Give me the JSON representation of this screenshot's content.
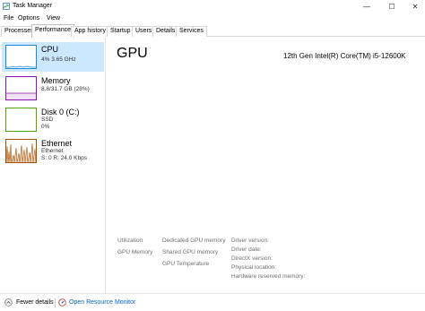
{
  "window": {
    "title": "Task Manager",
    "minimize_glyph": "—",
    "maximize_glyph": "☐",
    "close_glyph": "✕",
    "app_icon": "task-manager-icon"
  },
  "menu": [
    "File",
    "Options",
    "View"
  ],
  "tabs": [
    {
      "label": "Processes",
      "active": false
    },
    {
      "label": "Performance",
      "active": true
    },
    {
      "label": "App history",
      "active": false
    },
    {
      "label": "Startup",
      "active": false
    },
    {
      "label": "Users",
      "active": false
    },
    {
      "label": "Details",
      "active": false
    },
    {
      "label": "Services",
      "active": false
    }
  ],
  "sidebar": {
    "items": [
      {
        "title": "CPU",
        "subtitle": "4% 3.65 GHz",
        "selected": true,
        "color": "#1b89d4"
      },
      {
        "title": "Memory",
        "subtitle": "8.8/31.7 GB (28%)",
        "selected": false,
        "color": "#8b12ae"
      },
      {
        "title": "Disk 0 (C:)",
        "subtitle": "SSD",
        "subtitle2": "0%",
        "selected": false,
        "color": "#4da60c"
      },
      {
        "title": "Ethernet",
        "subtitle": "Ethernet",
        "subtitle2": "S: 0 R: 24.0 Kbps",
        "selected": false,
        "color": "#a74f01"
      }
    ]
  },
  "main": {
    "title": "GPU",
    "model": "12th Gen Intel(R) Core(TM) i5-12600K",
    "stats": {
      "utilization": "Utilization",
      "gpu_memory": "GPU Memory",
      "dedicated": "Dedicated GPU memory",
      "shared": "Shared GPU memory",
      "temperature": "GPU Temperature",
      "driver_version": "Driver version:",
      "driver_date": "Driver date:",
      "directx": "DirectX version:",
      "physical_location": "Physical location:",
      "reserved": "Hardware reserved memory:"
    }
  },
  "footer": {
    "fewer_details": "Fewer details",
    "open_monitor": "Open Resource Monitor"
  }
}
